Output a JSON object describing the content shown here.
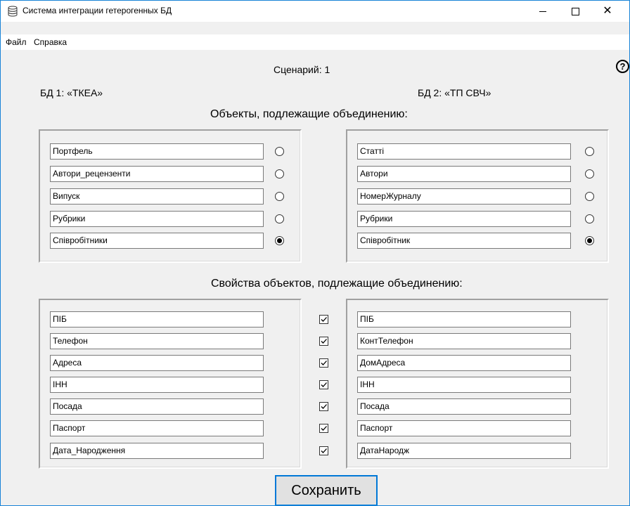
{
  "window": {
    "title": "Система интеграции гетерогенных БД",
    "icon": "database-icon",
    "controls": [
      "minimize-icon",
      "maximize-icon",
      "close-icon"
    ]
  },
  "menu": [
    "Файл",
    "Справка"
  ],
  "help_icon": "?",
  "scenario": "Сценарий: 1",
  "db1_label": "БД 1: «ТКЕА»",
  "db2_label": "БД 2: «ТП СВЧ»",
  "objects_heading": "Объекты, подлежащие объединению:",
  "objects_left": [
    {
      "value": "Портфель",
      "selected": false
    },
    {
      "value": "Автори_рецензенти",
      "selected": false
    },
    {
      "value": "Випуск",
      "selected": false
    },
    {
      "value": "Рубрики",
      "selected": false
    },
    {
      "value": "Співробітники",
      "selected": true
    }
  ],
  "objects_right": [
    {
      "value": "Статті",
      "selected": false
    },
    {
      "value": "Автори",
      "selected": false
    },
    {
      "value": "НомерЖурналу",
      "selected": false
    },
    {
      "value": "Рубрики",
      "selected": false
    },
    {
      "value": "Співробітник",
      "selected": true
    }
  ],
  "properties_heading": "Свойства объектов, подлежащие объединению:",
  "properties": [
    {
      "left": "ПІБ",
      "right": "ПІБ",
      "checked": true
    },
    {
      "left": "Телефон",
      "right": "КонтТелефон",
      "checked": true
    },
    {
      "left": "Адреса",
      "right": "ДомАдреса",
      "checked": true
    },
    {
      "left": "ІНН",
      "right": "ІНН",
      "checked": true
    },
    {
      "left": "Посада",
      "right": "Посада",
      "checked": true
    },
    {
      "left": "Паспорт",
      "right": "Паспорт",
      "checked": true
    },
    {
      "left": "Дата_Народження",
      "right": "ДатаНародж",
      "checked": true
    }
  ],
  "save_label": "Сохранить",
  "colors": {
    "accent": "#0078d7",
    "window_bg": "#f0f0f0",
    "window_border": "#1883d7"
  }
}
